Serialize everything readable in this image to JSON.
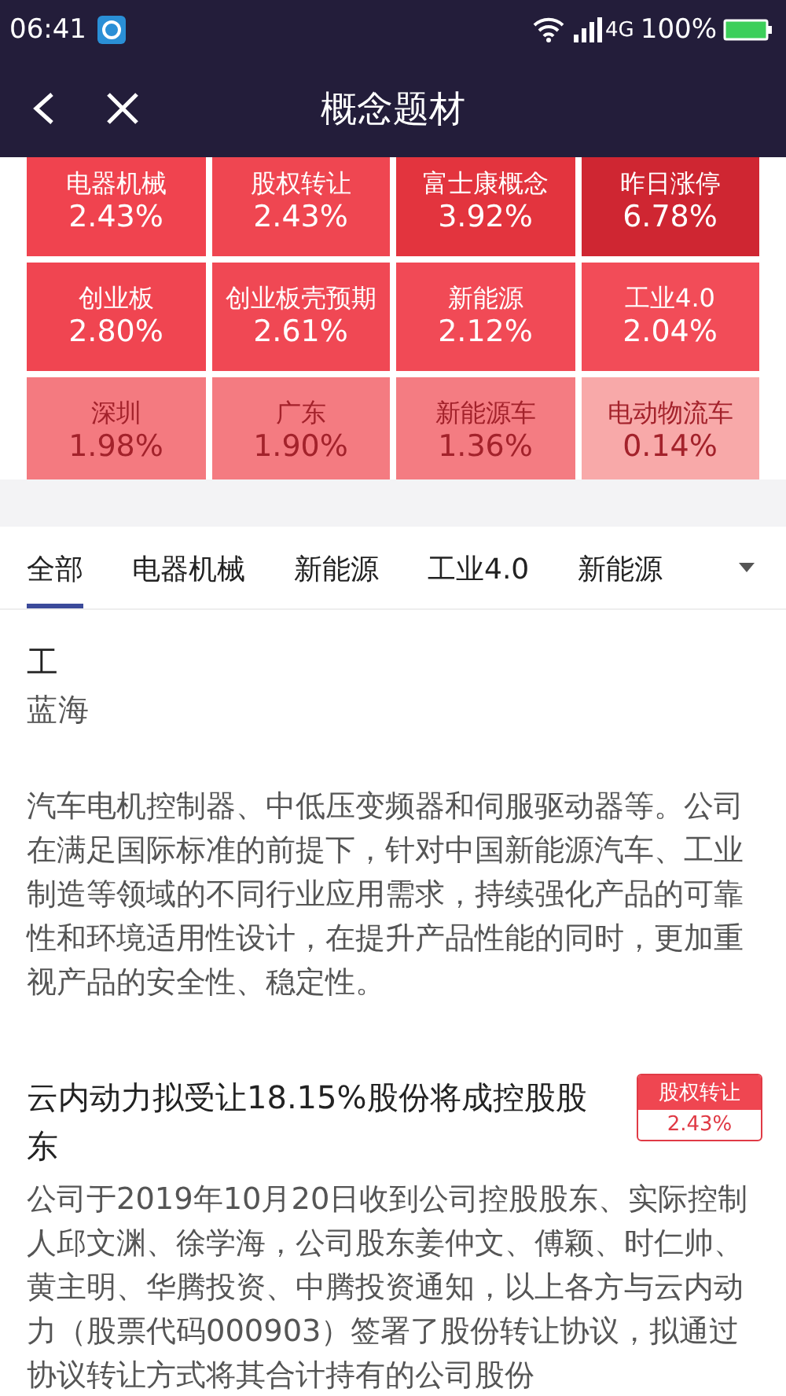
{
  "status_bar": {
    "time": "06:41",
    "network": "4G",
    "battery": "100%"
  },
  "header": {
    "title": "概念题材"
  },
  "tiles": [
    {
      "name": "电器机械",
      "change": "2.43%",
      "color": "#f0434f"
    },
    {
      "name": "股权转让",
      "change": "2.43%",
      "color": "#ef4651"
    },
    {
      "name": "富士康概念",
      "change": "3.92%",
      "color": "#e3343e"
    },
    {
      "name": "昨日涨停",
      "change": "6.78%",
      "color": "#cf2632"
    },
    {
      "name": "创业板",
      "change": "2.80%",
      "color": "#f04551"
    },
    {
      "name": "创业板壳预期",
      "change": "2.61%",
      "color": "#f04854"
    },
    {
      "name": "新能源",
      "change": "2.12%",
      "color": "#f14a56"
    },
    {
      "name": "工业4.0",
      "change": "2.04%",
      "color": "#f24c58"
    },
    {
      "name": "深圳",
      "change": "1.98%",
      "color": "#f47a80"
    },
    {
      "name": "广东",
      "change": "1.90%",
      "color": "#f47b81"
    },
    {
      "name": "新能源车",
      "change": "1.36%",
      "color": "#f47c82"
    },
    {
      "name": "电动物流车",
      "change": "0.14%",
      "color": "#f8a9a9"
    }
  ],
  "tabs": [
    {
      "label": "全部",
      "selected": true
    },
    {
      "label": "电器机械",
      "selected": false
    },
    {
      "label": "新能源",
      "selected": false
    },
    {
      "label": "工业4.0",
      "selected": false
    },
    {
      "label": "新能源",
      "selected": false
    }
  ],
  "articles": [
    {
      "title": "工",
      "lead": "蓝海",
      "body": "汽车电机控制器、中低压变频器和伺服驱动器等。公司在满足国际标准的前提下，针对中国新能源汽车、工业制造等领域的不同行业应用需求，持续强化产品的可靠性和环境适用性设计，在提升产品性能的同时，更加重视产品的安全性、稳定性。"
    },
    {
      "title": "云内动力拟受让18.15%股份将成控股股东",
      "tag": "股权转让",
      "tag_change": "2.43%",
      "body": "公司于2019年10月20日收到公司控股股东、实际控制人邱文渊、徐学海，公司股东姜仲文、傅颖、时仁帅、黄主明、华腾投资、中腾投资通知，以上各方与云内动力（股票代码000903）签署了股份转让协议，拟通过协议转让方式将其合计持有的公司股份"
    }
  ]
}
